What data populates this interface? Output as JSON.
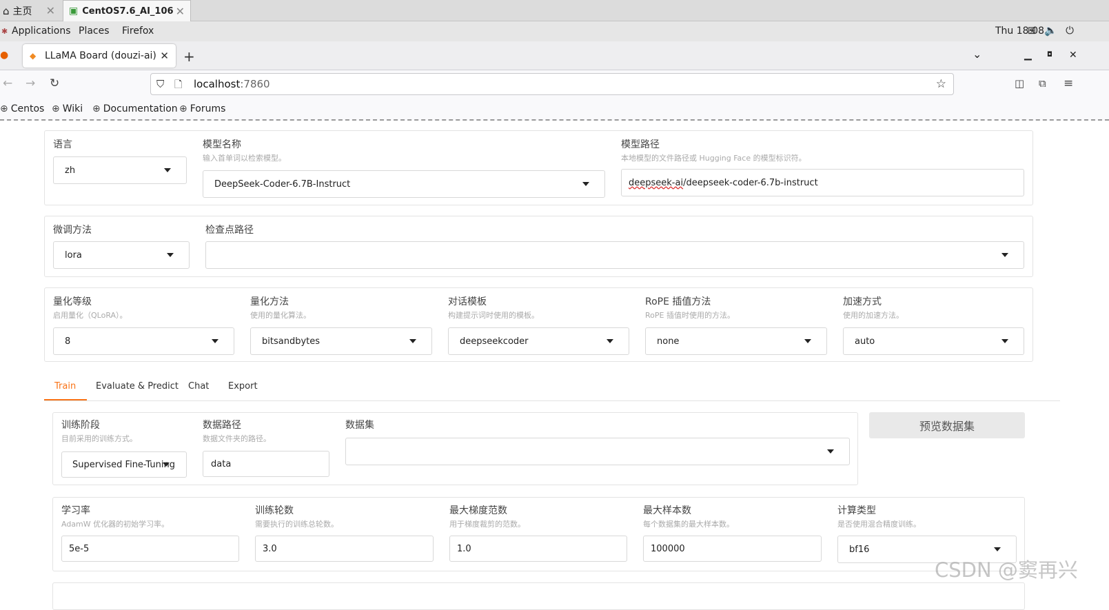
{
  "vm": {
    "home_label": "主页",
    "active_tab": "CentOS7.6_AI_106"
  },
  "gnome": {
    "applications": "Applications",
    "places": "Places",
    "firefox": "Firefox",
    "clock": "Thu 18:08"
  },
  "firefox": {
    "tab_title": "LLaMA Board (douzi-ai)",
    "url_host": "localhost",
    "url_port": ":7860",
    "bookmarks": [
      "Centos",
      "Wiki",
      "Documentation",
      "Forums"
    ]
  },
  "model": {
    "lang_label": "语言",
    "lang_value": "zh",
    "name_label": "模型名称",
    "name_info": "输入首单词以检索模型。",
    "name_value": "DeepSeek-Coder-6.7B-Instruct",
    "path_label": "模型路径",
    "path_info": "本地模型的文件路径或 Hugging Face 的模型标识符。",
    "path_value_org": "deepseek-ai",
    "path_value_rest": "/deepseek-coder-6.7b-instruct"
  },
  "finetune": {
    "method_label": "微调方法",
    "method_value": "lora",
    "checkpoint_label": "检查点路径",
    "checkpoint_value": ""
  },
  "advanced": {
    "quant_bit_label": "量化等级",
    "quant_bit_info": "启用量化（QLoRA）。",
    "quant_bit_value": "8",
    "quant_method_label": "量化方法",
    "quant_method_info": "使用的量化算法。",
    "quant_method_value": "bitsandbytes",
    "template_label": "对话模板",
    "template_info": "构建提示词时使用的模板。",
    "template_value": "deepseekcoder",
    "rope_label": "RoPE 插值方法",
    "rope_info": "RoPE 插值时使用的方法。",
    "rope_value": "none",
    "booster_label": "加速方式",
    "booster_info": "使用的加速方法。",
    "booster_value": "auto"
  },
  "tabs": [
    "Train",
    "Evaluate & Predict",
    "Chat",
    "Export"
  ],
  "train": {
    "stage_label": "训练阶段",
    "stage_info": "目前采用的训练方式。",
    "stage_value": "Supervised Fine-Tuning",
    "dataset_dir_label": "数据路径",
    "dataset_dir_info": "数据文件夹的路径。",
    "dataset_dir_value": "data",
    "dataset_label": "数据集",
    "dataset_value": "",
    "preview_button": "预览数据集",
    "lr_label": "学习率",
    "lr_info": "AdamW 优化器的初始学习率。",
    "lr_value": "5e-5",
    "epochs_label": "训练轮数",
    "epochs_info": "需要执行的训练总轮数。",
    "epochs_value": "3.0",
    "max_grad_norm_label": "最大梯度范数",
    "max_grad_norm_info": "用于梯度裁剪的范数。",
    "max_grad_norm_value": "1.0",
    "max_samples_label": "最大样本数",
    "max_samples_info": "每个数据集的最大样本数。",
    "max_samples_value": "100000",
    "compute_type_label": "计算类型",
    "compute_type_info": "是否使用混合精度训练。",
    "compute_type_value": "bf16"
  },
  "watermark": "CSDN @窦再兴",
  "colors": {
    "accent": "#f97316"
  }
}
